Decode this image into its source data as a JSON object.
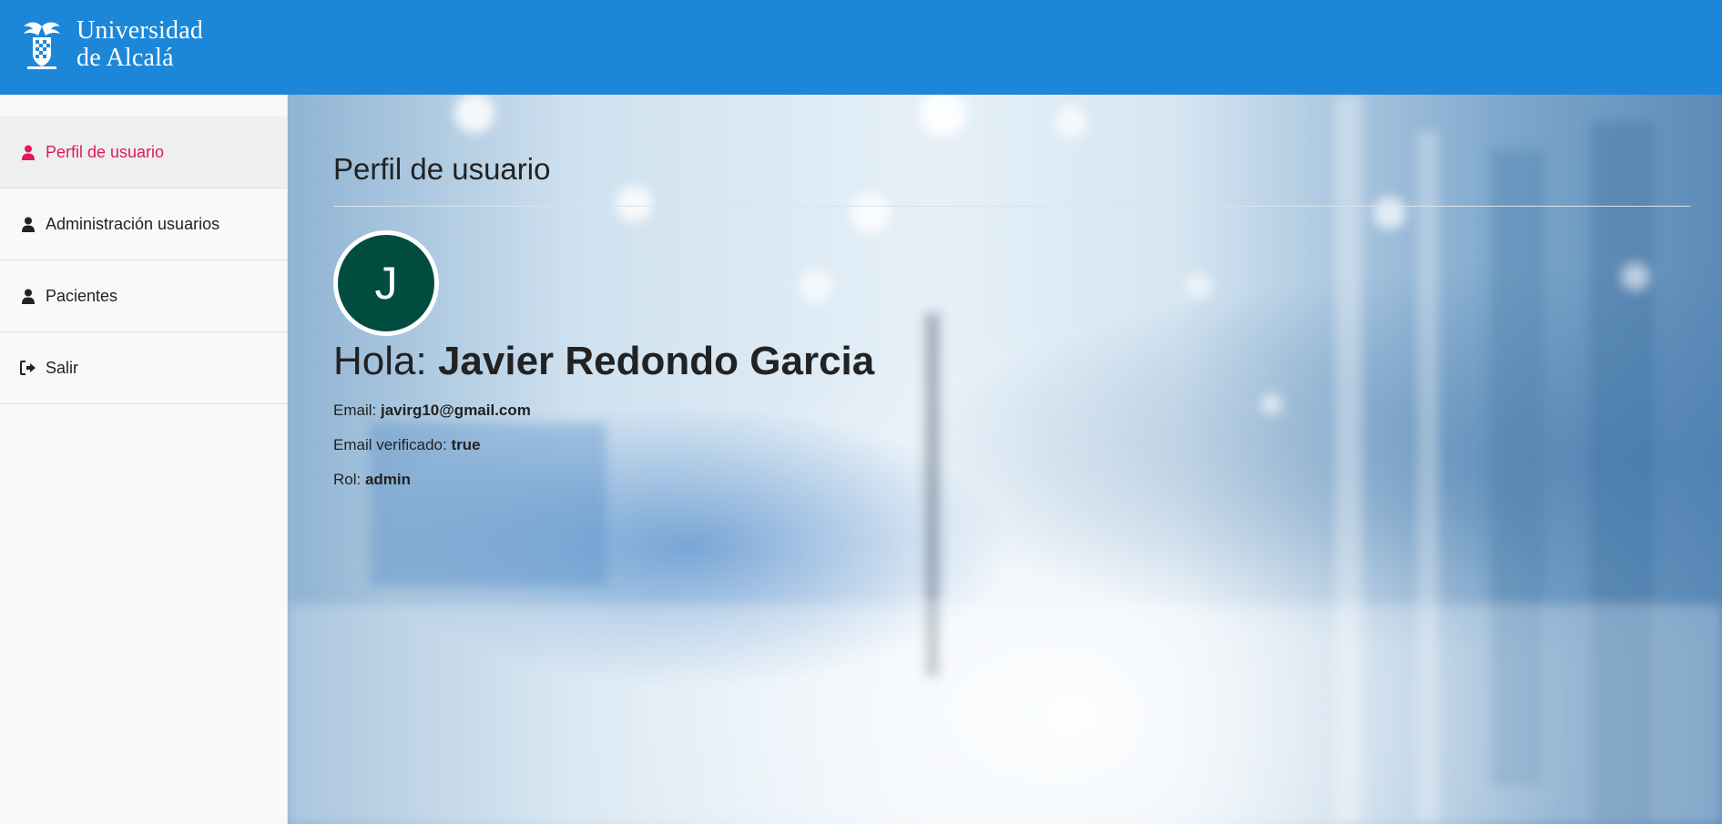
{
  "header": {
    "logo_line1": "Universidad",
    "logo_line2": "de Alcalá",
    "background": "#1c87d9"
  },
  "sidebar": {
    "items": [
      {
        "label": "Perfil de usuario",
        "icon": "user-icon",
        "active": true
      },
      {
        "label": "Administración usuarios",
        "icon": "user-icon",
        "active": false
      },
      {
        "label": "Pacientes",
        "icon": "user-icon",
        "active": false
      },
      {
        "label": "Salir",
        "icon": "sign-out-icon",
        "active": false
      }
    ],
    "active_color": "#e0185c"
  },
  "main": {
    "title": "Perfil de usuario",
    "avatar_letter": "J",
    "avatar_color": "#004d40",
    "greeting_prefix": "Hola: ",
    "user_name": "Javier Redondo Garcia",
    "email_label": "Email: ",
    "email_value": "javirg10@gmail.com",
    "verified_label": "Email verificado: ",
    "verified_value": "true",
    "role_label": "Rol: ",
    "role_value": "admin"
  }
}
